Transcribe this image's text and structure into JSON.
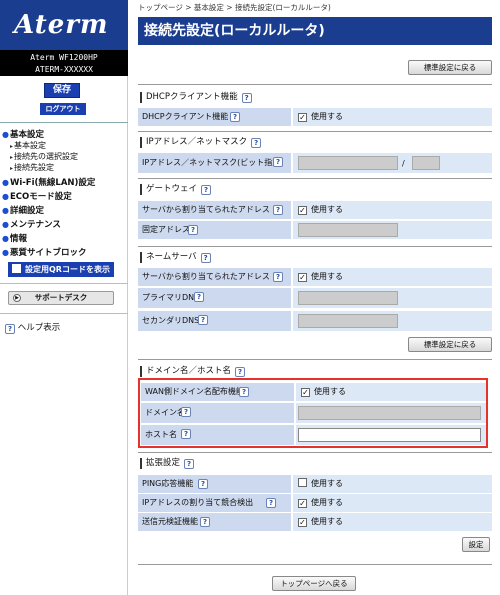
{
  "sidebar": {
    "logo": "Aterm",
    "model_line1": "Aterm WF1200HP",
    "model_line2": "ATERM-XXXXXX",
    "save_label": "保存",
    "logout_label": "ログアウト",
    "menu": {
      "basic": "基本設定",
      "basic_sub1": "基本設定",
      "basic_sub2": "接続先の選択設定",
      "basic_sub3": "接続先設定",
      "wifi": "Wi-Fi(無線LAN)設定",
      "eco": "ECOモード設定",
      "detail": "詳細設定",
      "maint": "メンテナンス",
      "info": "情報",
      "block": "悪質サイトブロック"
    },
    "qr_label": "設定用QRコードを表示",
    "support_label": "サポートデスク",
    "help_label": "ヘルプ表示"
  },
  "breadcrumb": "トップページ > 基本設定 > 接続先設定(ローカルルータ)",
  "page_title": "接続先設定(ローカルルータ)",
  "buttons": {
    "default_top": "標準設定に戻る",
    "default_mid": "標準設定に戻る",
    "apply": "設定",
    "back_top": "トップページへ戻る"
  },
  "sections": {
    "dhcp": {
      "title": "DHCPクライアント機能",
      "label": "DHCPクライアント機能",
      "value": "使用する",
      "checked": true
    },
    "ip": {
      "title": "IPアドレス／ネットマスク",
      "label": "IPアドレス／ネットマスク(ビット指定)",
      "sep": "/"
    },
    "gateway": {
      "title": "ゲートウェイ",
      "label1": "サーバから割り当てられたアドレス",
      "value1": "使用する",
      "checked1": true,
      "label2": "固定アドレス"
    },
    "dns": {
      "title": "ネームサーバ",
      "label1": "サーバから割り当てられたアドレス",
      "value1": "使用する",
      "checked1": true,
      "label2": "プライマリDNS",
      "label3": "セカンダリDNS"
    },
    "domain": {
      "title": "ドメイン名／ホスト名",
      "label1": "WAN側ドメイン名配布機能",
      "value1": "使用する",
      "checked1": true,
      "label2": "ドメイン名",
      "label3": "ホスト名"
    },
    "ext": {
      "title": "拡張設定",
      "label1": "PING応答機能",
      "value1": "使用する",
      "checked1": false,
      "label2": "IPアドレスの割り当て競合検出",
      "value2": "使用する",
      "checked2": true,
      "label3": "送信元検証機能",
      "value3": "使用する",
      "checked3": true
    }
  },
  "help_icon": "?",
  "check_mark": "✓",
  "colors": {
    "brand": "#1b3d8f",
    "button_blue": "#1a3fb0",
    "highlight": "#e5322d",
    "row_bg": "#dde8f6"
  }
}
